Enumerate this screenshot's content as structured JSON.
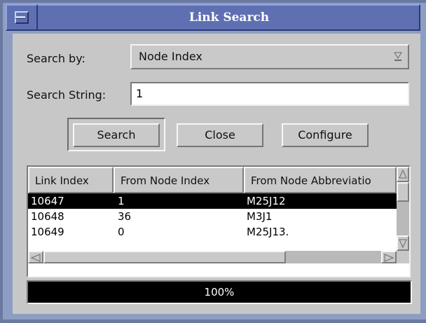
{
  "window": {
    "title": "Link Search"
  },
  "form": {
    "search_by_label": "Search by:",
    "search_by_value": "Node Index",
    "search_string_label": "Search String:",
    "search_string_value": "1"
  },
  "buttons": {
    "search": "Search",
    "close": "Close",
    "configure": "Configure"
  },
  "table": {
    "columns": [
      "Link Index",
      "From Node Index",
      "From Node Abbreviatio"
    ],
    "rows": [
      [
        "10647",
        "1",
        "M25J12"
      ],
      [
        "10648",
        "36",
        "M3J1"
      ],
      [
        "10649",
        "0",
        "M25J13."
      ]
    ],
    "selected_row": 0
  },
  "progress": {
    "value": 1.0,
    "label": "100%"
  },
  "icons": {
    "window_menu": "window-menu-icon",
    "dropdown": "dropdown-arrow-icon",
    "scroll_up": "scroll-up-arrow-icon",
    "scroll_down": "scroll-down-arrow-icon",
    "scroll_left": "scroll-left-arrow-icon",
    "scroll_right": "scroll-right-arrow-icon"
  }
}
